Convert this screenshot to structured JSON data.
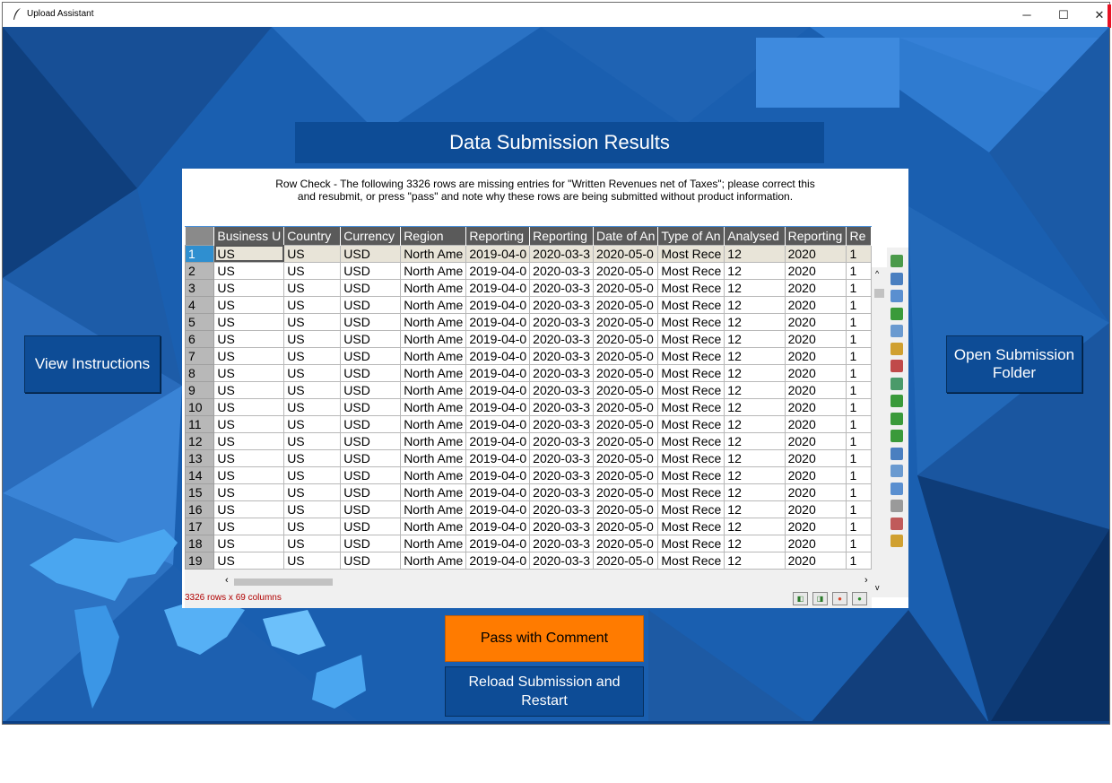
{
  "window": {
    "title": "Upload Assistant",
    "controls": {
      "minimize": "─",
      "maximize": "☐",
      "close": "✕"
    }
  },
  "banner": {
    "title": "Data Submission Results"
  },
  "message": "Row Check - The following 3326 rows are missing entries for \"Written Revenues net of Taxes\"; please correct this and resubmit, or press \"pass\" and note why these rows are being submitted without product information.",
  "table": {
    "columns": [
      "Business U",
      "Country",
      "Currency",
      "Region",
      "Reporting",
      "Reporting",
      "Date of An",
      "Type of An",
      "Analysed",
      "Reporting",
      "Re"
    ],
    "row_template": [
      "US",
      "US",
      "USD",
      "North Ame",
      "2019-04-0",
      "2020-03-3",
      "2020-05-0",
      "Most Rece",
      "12",
      "2020",
      "1"
    ],
    "row_numbers": [
      "1",
      "2",
      "3",
      "4",
      "5",
      "6",
      "7",
      "8",
      "9",
      "10",
      "11",
      "12",
      "13",
      "14",
      "15",
      "16",
      "17",
      "18",
      "19"
    ],
    "selected_row": "1",
    "status": "3326 rows x 69 columns"
  },
  "buttons": {
    "view_instructions": "View Instructions",
    "open_folder": "Open Submission Folder",
    "pass_comment": "Pass with Comment",
    "reload_restart": "Reload Submission and Restart"
  },
  "colors": {
    "background": "#1a5fb0",
    "button_blue": "#0d4c96",
    "button_orange": "#ff7b00",
    "header_gray": "#5a5a5a",
    "selected_row": "#2f8fd0",
    "status_text": "#b00000"
  },
  "toolbar_icons": [
    "select-icon",
    "copy-icon",
    "paste-icon",
    "excel-icon",
    "duplicate-icon",
    "clipboard-icon",
    "chart-icon",
    "gear-icon",
    "forward-icon",
    "undo-icon",
    "back-icon",
    "function-icon",
    "table-icon",
    "save-icon",
    "calculator-icon",
    "filter-icon",
    "export-icon"
  ]
}
